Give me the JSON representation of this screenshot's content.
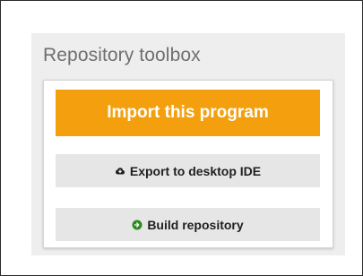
{
  "toolbox": {
    "title": "Repository toolbox",
    "import_label": "Import this program",
    "export_label": "Export to desktop IDE",
    "build_label": "Build repository"
  },
  "icons": {
    "export": "cloud-download-icon",
    "build": "arrow-circle-right-icon"
  },
  "colors": {
    "import_button": "#f4a00e",
    "build_icon": "#2e8b1f"
  }
}
